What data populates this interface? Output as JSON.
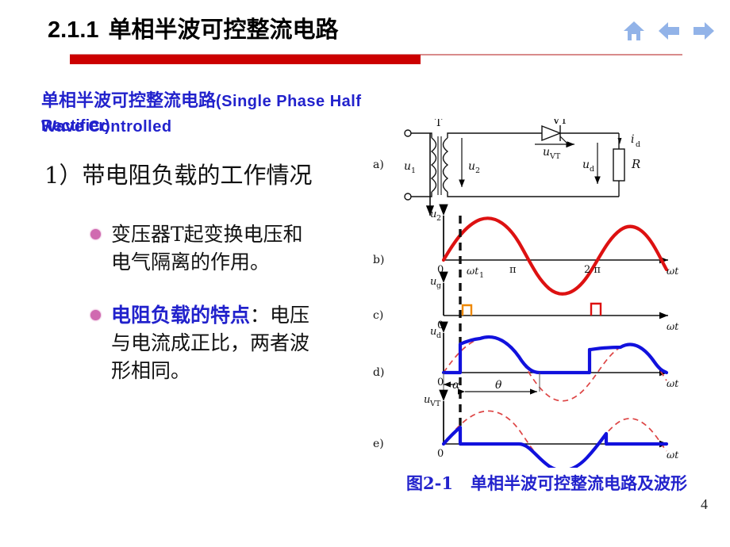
{
  "header": {
    "section_number": "2.1.1",
    "section_title": "单相半波可控整流电路",
    "nav_icons": [
      "home-icon",
      "arrow-left-icon",
      "arrow-right-icon"
    ],
    "rule_color": "#cc0000"
  },
  "content": {
    "heading_cn": "单相半波可控整流电路",
    "heading_en_line1": "(Single Phase Half  Wave Controlled",
    "heading_en_line2": "Rectifier)",
    "heading_color": "#2222cc",
    "item1": "1）带电阻负载的工作情况",
    "bullets": [
      {
        "text": "变压器T起变换电压和电气隔离的作用。",
        "highlight": "",
        "rest": ""
      },
      {
        "text": "电阻负载的特点：电压与电流成正比，两者波形相同。",
        "highlight": "电阻负载的特点",
        "rest": "：电压与电流成正比，两者波形相同。"
      }
    ],
    "bullet_color": "#d06ab0"
  },
  "figure": {
    "caption_number": "图2-1",
    "caption_text": "单相半波可控整流电路及波形",
    "caption_color": "#2222cc",
    "panels": [
      {
        "id": "a",
        "label": "a)",
        "kind": "circuit"
      },
      {
        "id": "b",
        "label": "b)",
        "kind": "waveform",
        "ylabel_main": "u",
        "ylabel_sub": "2",
        "xlabel": "ωt",
        "curve_color": "#dd1111"
      },
      {
        "id": "c",
        "label": "c)",
        "kind": "waveform",
        "ylabel_main": "u",
        "ylabel_sub": "g",
        "xlabel": "ωt",
        "curve_color": "#ee8800"
      },
      {
        "id": "d",
        "label": "d)",
        "kind": "waveform",
        "ylabel_main": "u",
        "ylabel_sub": "d",
        "xlabel": "ωt",
        "curve_color": "#1111dd"
      },
      {
        "id": "e",
        "label": "e)",
        "kind": "waveform",
        "ylabel_main": "u",
        "ylabel_sub": "VT",
        "xlabel": "ωt",
        "curve_color": "#1111dd"
      }
    ],
    "circuit_labels": {
      "transformer": "T",
      "thyristor": "VT",
      "primary_voltage_main": "u",
      "primary_voltage_sub": "1",
      "secondary_voltage_main": "u",
      "secondary_voltage_sub": "2",
      "thyristor_voltage_main": "u",
      "thyristor_voltage_sub": "VT",
      "load_voltage_main": "u",
      "load_voltage_sub": "d",
      "load_current_main": "i",
      "load_current_sub": "d",
      "resistor": "R"
    },
    "axis_ticks_b": [
      "0",
      "ωt",
      "π",
      "2 π"
    ],
    "tick_wt1_main": "ωt",
    "tick_wt1_sub": "1",
    "tick_pi": "π",
    "tick_2pi": "2 π",
    "tick_zero": "0",
    "angle_alpha": "α",
    "angle_theta": "θ"
  },
  "chart_data": {
    "type": "line",
    "title": "图2-1 单相半波可控整流电路及波形",
    "xlabel": "ωt",
    "x_ticks": [
      0,
      3.14159,
      6.28318
    ],
    "x_tick_labels": [
      "0",
      "π",
      "2 π"
    ],
    "firing_angle_alpha_rad": 0.52,
    "conduction_angle_theta_rad": 2.62,
    "grid": false,
    "legend": "none",
    "series": [
      {
        "name": "u2",
        "panel": "b",
        "type": "sine",
        "color": "#dd1111",
        "amplitude": 1.0,
        "description": "full sine wave over 0..2π"
      },
      {
        "name": "ug",
        "panel": "c",
        "type": "pulses",
        "color": "#ee8800",
        "pulse_positions_rad": [
          0.52,
          6.81
        ],
        "pulse_height": 0.35,
        "description": "narrow gate trigger pulses at alpha and alpha+2pi"
      },
      {
        "name": "ud",
        "panel": "d",
        "type": "half-wave-rectified",
        "color": "#1111dd",
        "description": "zero until alpha, follows sine alpha..π, zero until alpha+2π"
      },
      {
        "name": "u2-reference-d",
        "panel": "d",
        "type": "sine-dashed",
        "color": "#dd4444",
        "description": "dashed red reference sine"
      },
      {
        "name": "uVT",
        "panel": "e",
        "type": "thyristor-voltage",
        "color": "#1111dd",
        "description": "follows sine 0..alpha, zero alpha..π, follows sine π..2π"
      },
      {
        "name": "u2-reference-e",
        "panel": "e",
        "type": "sine-dashed",
        "color": "#dd4444",
        "description": "dashed red reference sine"
      }
    ]
  },
  "page": {
    "number": "4"
  }
}
